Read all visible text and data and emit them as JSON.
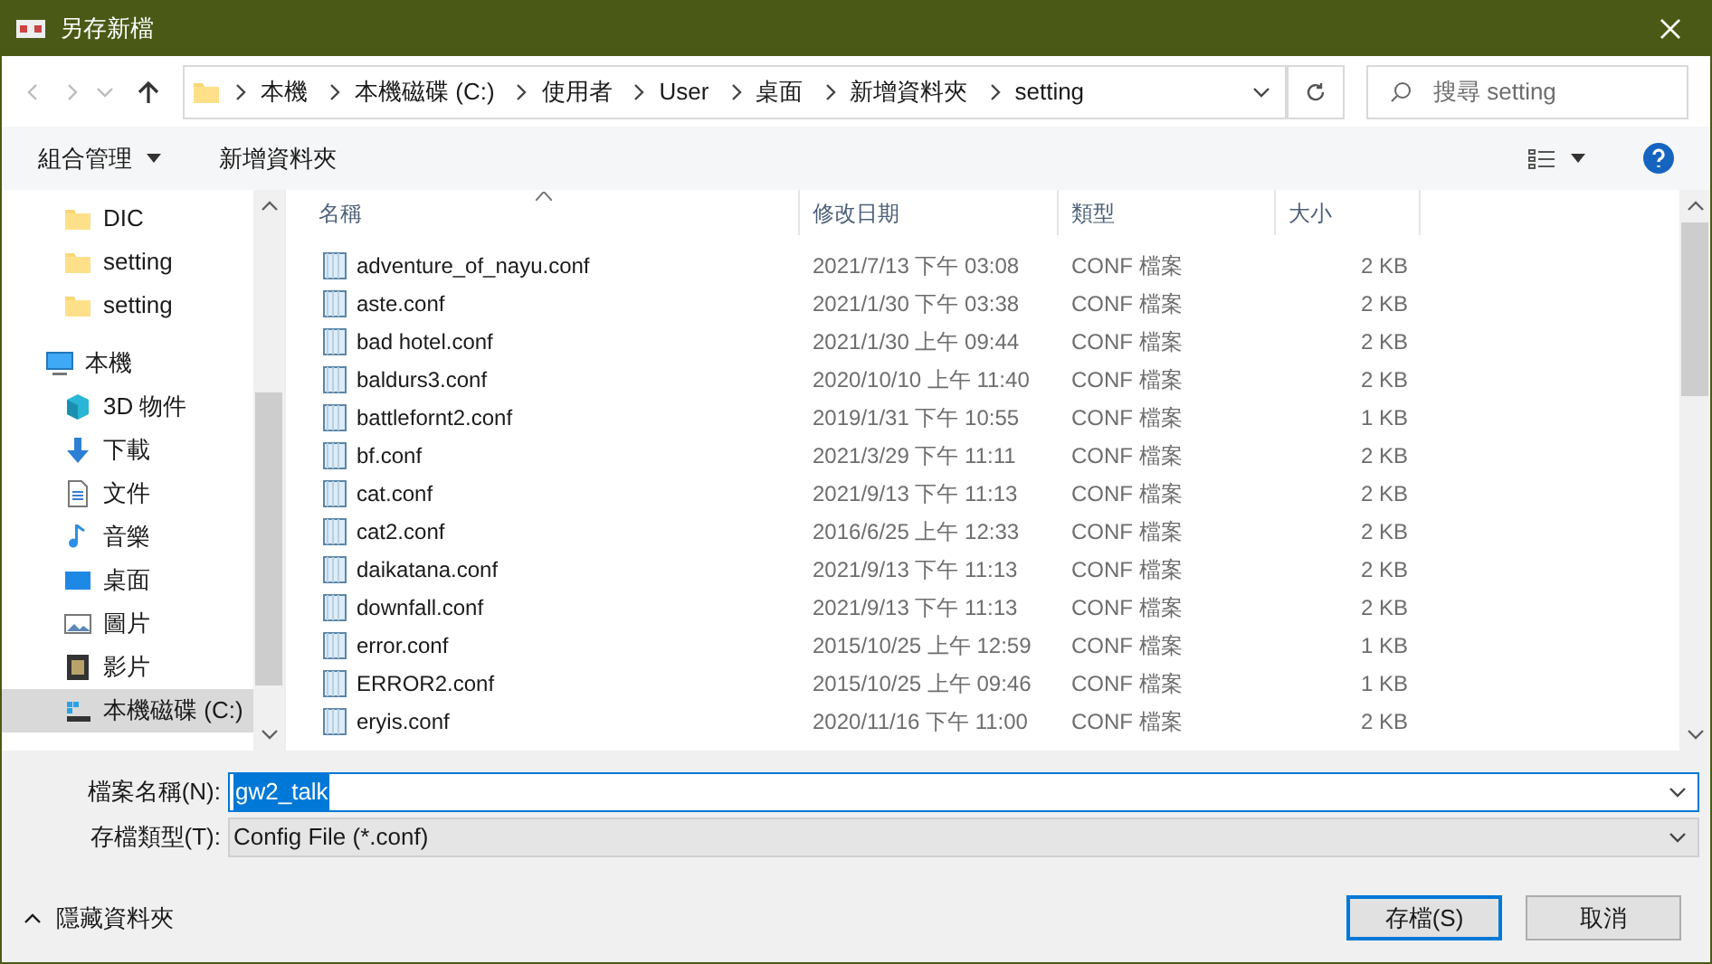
{
  "window": {
    "title": "另存新檔"
  },
  "address": {
    "crumbs": [
      "本機",
      "本機磁碟 (C:)",
      "使用者",
      "User",
      "桌面",
      "新增資料夾",
      "setting"
    ]
  },
  "search": {
    "placeholder": "搜尋 setting"
  },
  "toolbar": {
    "organize": "組合管理",
    "new_folder": "新增資料夾"
  },
  "sidebar": {
    "items": [
      {
        "label": "DIC",
        "kind": "folder",
        "selected": false
      },
      {
        "label": "setting",
        "kind": "folder",
        "selected": false
      },
      {
        "label": "setting",
        "kind": "folder",
        "selected": false
      },
      {
        "label": "本機",
        "kind": "pc",
        "selected": false,
        "children": [
          {
            "label": "3D 物件",
            "kind": "cube",
            "selected": false
          },
          {
            "label": "下載",
            "kind": "download",
            "selected": false
          },
          {
            "label": "文件",
            "kind": "document",
            "selected": false
          },
          {
            "label": "音樂",
            "kind": "music",
            "selected": false
          },
          {
            "label": "桌面",
            "kind": "desktop",
            "selected": false
          },
          {
            "label": "圖片",
            "kind": "pictures",
            "selected": false
          },
          {
            "label": "影片",
            "kind": "video",
            "selected": false
          },
          {
            "label": "本機磁碟 (C:)",
            "kind": "drive",
            "selected": true
          }
        ]
      }
    ]
  },
  "table": {
    "columns": [
      "名稱",
      "修改日期",
      "類型",
      "大小"
    ],
    "rows": [
      [
        "adventure_of_nayu.conf",
        "2021/7/13 下午 03:08",
        "CONF 檔案",
        "2 KB"
      ],
      [
        "aste.conf",
        "2021/1/30 下午 03:38",
        "CONF 檔案",
        "2 KB"
      ],
      [
        "bad hotel.conf",
        "2021/1/30 上午 09:44",
        "CONF 檔案",
        "2 KB"
      ],
      [
        "baldurs3.conf",
        "2020/10/10 上午 11:40",
        "CONF 檔案",
        "2 KB"
      ],
      [
        "battlefornt2.conf",
        "2019/1/31 下午 10:55",
        "CONF 檔案",
        "1 KB"
      ],
      [
        "bf.conf",
        "2021/3/29 下午 11:11",
        "CONF 檔案",
        "2 KB"
      ],
      [
        "cat.conf",
        "2021/9/13 下午 11:13",
        "CONF 檔案",
        "2 KB"
      ],
      [
        "cat2.conf",
        "2016/6/25 上午 12:33",
        "CONF 檔案",
        "2 KB"
      ],
      [
        "daikatana.conf",
        "2021/9/13 下午 11:13",
        "CONF 檔案",
        "2 KB"
      ],
      [
        "downfall.conf",
        "2021/9/13 下午 11:13",
        "CONF 檔案",
        "2 KB"
      ],
      [
        "error.conf",
        "2015/10/25 上午 12:59",
        "CONF 檔案",
        "1 KB"
      ],
      [
        "ERROR2.conf",
        "2015/10/25 上午 09:46",
        "CONF 檔案",
        "1 KB"
      ],
      [
        "eryis.conf",
        "2020/11/16 下午 11:00",
        "CONF 檔案",
        "2 KB"
      ]
    ]
  },
  "form": {
    "filename_label": "檔案名稱(N):",
    "filename": "gw2_talk",
    "type_label": "存檔類型(T):",
    "type": "Config File (*.conf)"
  },
  "footer": {
    "hide_folders": "隱藏資料夾",
    "save": "存檔(S)",
    "cancel": "取消"
  }
}
